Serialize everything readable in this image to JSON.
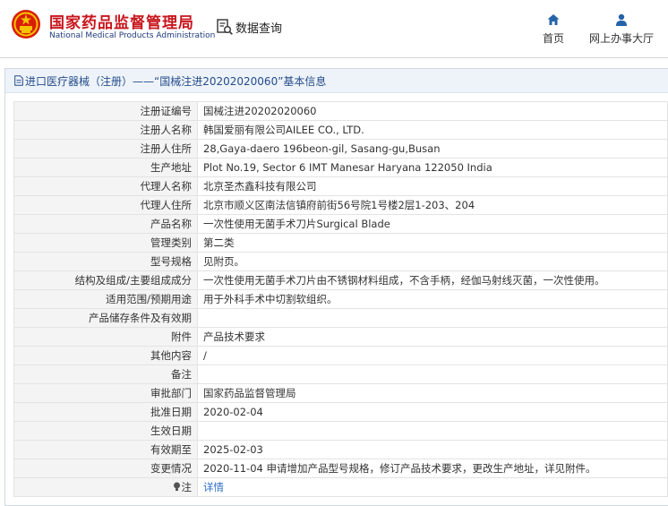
{
  "header": {
    "brand_cn": "国家药品监督管理局",
    "brand_en": "National Medical Products Administration",
    "query_label": "数据查询",
    "nav": [
      {
        "label": "首页",
        "icon": "home-icon"
      },
      {
        "label": "网上办事大厅",
        "icon": "user-icon"
      }
    ]
  },
  "colors": {
    "brand_red": "#c8161d",
    "brand_blue": "#1f3a7a",
    "link_blue": "#2d6cc8"
  },
  "panel": {
    "title": "进口医疗器械（注册）——“国械注进20202020060”基本信息"
  },
  "rows": [
    {
      "label": "注册证编号",
      "value": "国械注进20202020060"
    },
    {
      "label": "注册人名称",
      "value": "韩国爱丽有限公司AILEE CO., LTD."
    },
    {
      "label": "注册人住所",
      "value": "28,Gaya-daero 196beon-gil, Sasang-gu,Busan"
    },
    {
      "label": "生产地址",
      "value": "Plot No.19, Sector 6 IMT Manesar Haryana 122050 India"
    },
    {
      "label": "代理人名称",
      "value": "北京圣杰鑫科技有限公司"
    },
    {
      "label": "代理人住所",
      "value": "北京市顺义区南法信镇府前街56号院1号楼2层1-203、204"
    },
    {
      "label": "产品名称",
      "value": "一次性使用无菌手术刀片Surgical Blade"
    },
    {
      "label": "管理类别",
      "value": "第二类"
    },
    {
      "label": "型号规格",
      "value": "见附页。"
    },
    {
      "label": "结构及组成/主要组成成分",
      "value": "一次性使用无菌手术刀片由不锈钢材料组成，不含手柄，经伽马射线灭菌，一次性使用。"
    },
    {
      "label": "适用范围/预期用途",
      "value": "用于外科手术中切割软组织。"
    },
    {
      "label": "产品储存条件及有效期",
      "value": ""
    },
    {
      "label": "附件",
      "value": "产品技术要求"
    },
    {
      "label": "其他内容",
      "value": "/"
    },
    {
      "label": "备注",
      "value": ""
    },
    {
      "label": "审批部门",
      "value": "国家药品监督管理局"
    },
    {
      "label": "批准日期",
      "value": "2020-02-04"
    },
    {
      "label": "生效日期",
      "value": ""
    },
    {
      "label": "有效期至",
      "value": "2025-02-03"
    },
    {
      "label": "变更情况",
      "value": "2020-11-04 申请增加产品型号规格，修订产品技术要求，更改生产地址，详见附件。"
    }
  ],
  "note": {
    "label": "注",
    "link": "详情",
    "icon": "bulb-icon"
  }
}
